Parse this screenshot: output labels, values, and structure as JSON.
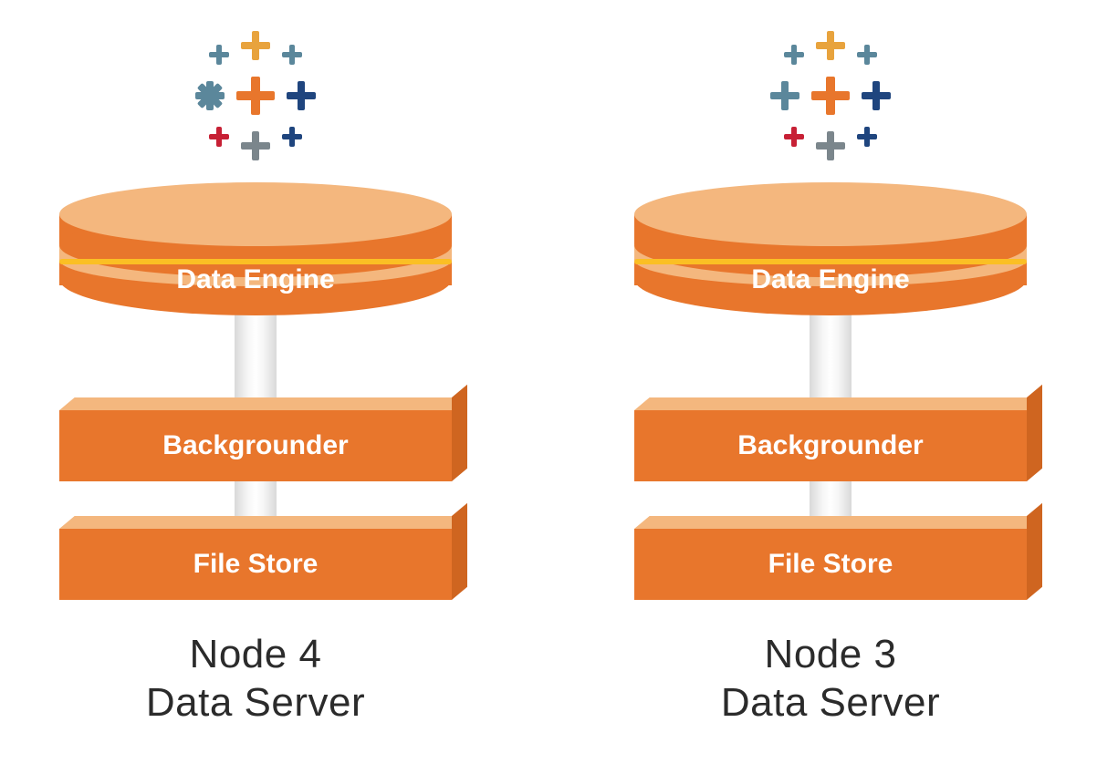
{
  "colors": {
    "orange_main": "#E8762C",
    "orange_light": "#F4B77E",
    "orange_band": "#FBBF24",
    "logo_orange": "#E8762C",
    "logo_red": "#C72035",
    "logo_navy": "#1F457E",
    "logo_teal": "#5B879B",
    "logo_gold": "#E8A33D",
    "logo_grey": "#7B868C",
    "text": "#2b2b2b"
  },
  "nodes": [
    {
      "id": "node4",
      "layers": [
        "Data Engine",
        "Backgrounder",
        "File Store"
      ],
      "caption_line1": "Node 4",
      "caption_line2": "Data Server"
    },
    {
      "id": "node3",
      "layers": [
        "Data Engine",
        "Backgrounder",
        "File Store"
      ],
      "caption_line1": "Node 3",
      "caption_line2": "Data Server"
    }
  ]
}
